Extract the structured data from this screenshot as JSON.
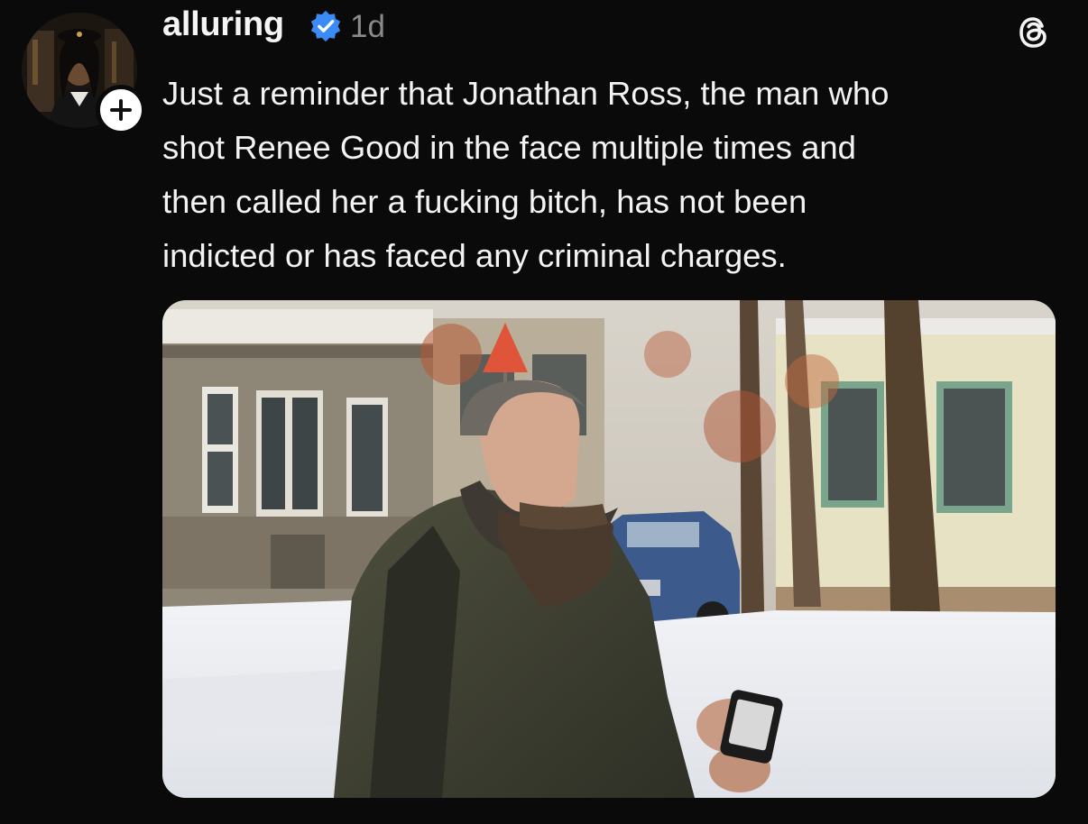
{
  "post": {
    "username": "alluring",
    "verified": true,
    "timestamp": "1d",
    "text_lines": [
      "Just a reminder that Jonathan Ross, the man who",
      "shot Renee Good in the face multiple times and",
      "then called her a fucking bitch, has not been",
      "indicted or has faced any criminal charges."
    ],
    "media": {
      "type": "photo"
    }
  },
  "icons": {
    "verified": "verified-badge-icon",
    "threads": "threads-logo-icon",
    "follow": "plus-icon"
  },
  "colors": {
    "background": "#0a0a0a",
    "text": "#f3f3f3",
    "muted": "#8a8a8a",
    "verified_blue": "#3a8bf5"
  }
}
